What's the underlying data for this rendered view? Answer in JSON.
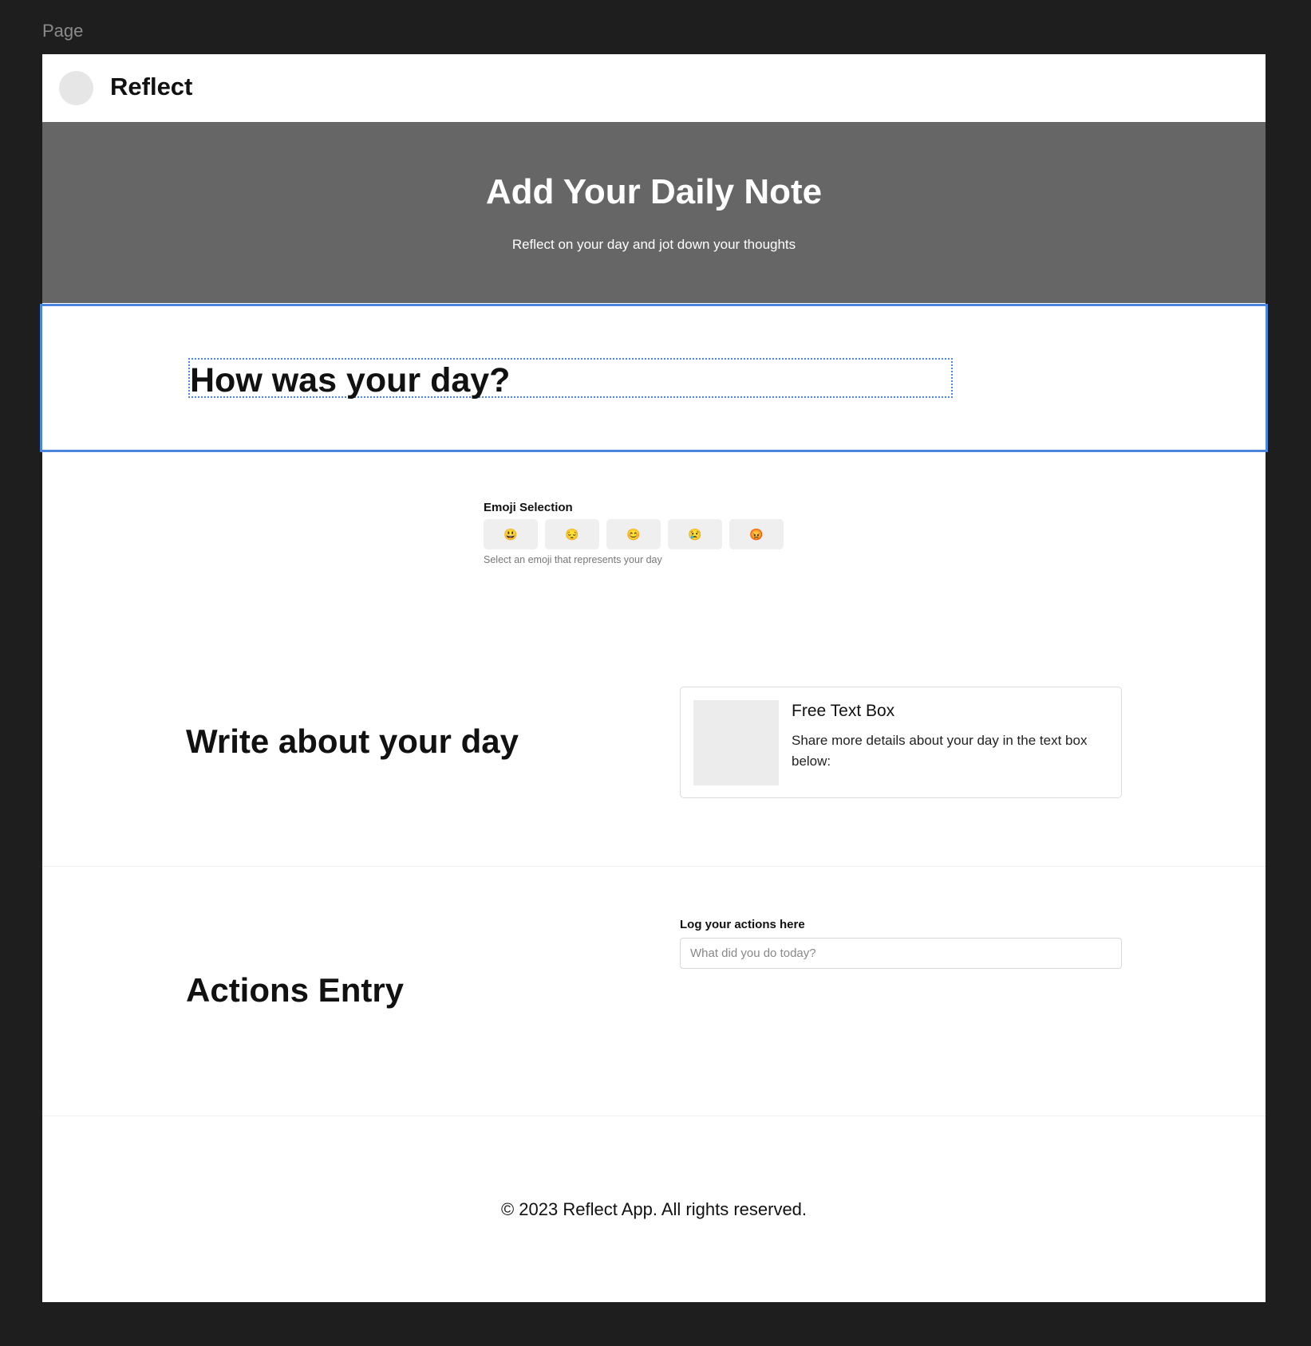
{
  "canvas": {
    "label": "Page"
  },
  "header": {
    "app_name": "Reflect"
  },
  "hero": {
    "title": "Add Your Daily Note",
    "subtitle": "Reflect on your day and jot down your thoughts"
  },
  "question": {
    "heading": "How was your day?"
  },
  "emoji": {
    "label": "Emoji Selection",
    "options": [
      "😃",
      "😔",
      "😊",
      "😢",
      "😡"
    ],
    "help": "Select an emoji that represents your day"
  },
  "write": {
    "heading": "Write about your day",
    "card_title": "Free Text Box",
    "card_desc": "Share more details about your day in the text box below:"
  },
  "actions": {
    "heading": "Actions Entry",
    "label": "Log your actions here",
    "placeholder": "What did you do today?",
    "value": ""
  },
  "footer": {
    "text": "© 2023 Reflect App. All rights reserved."
  },
  "colors": {
    "canvas_bg": "#1e1e1e",
    "hero_bg": "#666666",
    "selection": "#4a86e0"
  }
}
